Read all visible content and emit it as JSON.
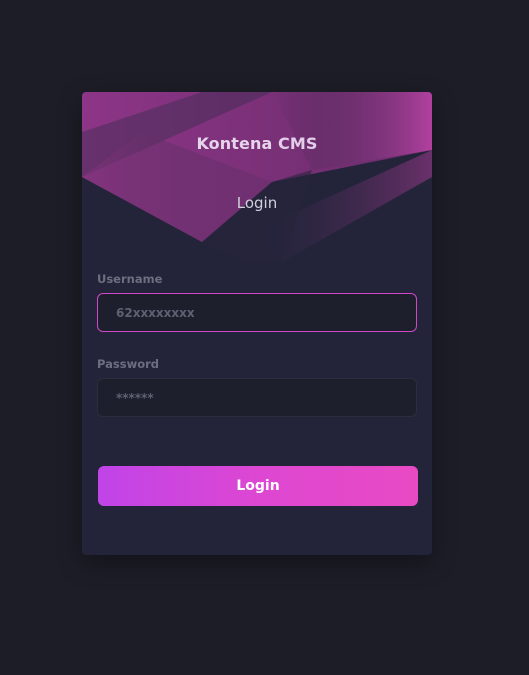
{
  "brand": {
    "name": "Kontena",
    "suffix": "CMS"
  },
  "form": {
    "title": "Login",
    "username": {
      "label": "Username",
      "placeholder": "62xxxxxxxx",
      "value": ""
    },
    "password": {
      "label": "Password",
      "placeholder": "******",
      "value": ""
    },
    "submit_label": "Login"
  },
  "colors": {
    "background": "#1d1d27",
    "card": "#23243a",
    "accent": "#dd47d2",
    "header_art": "#a03b94"
  }
}
